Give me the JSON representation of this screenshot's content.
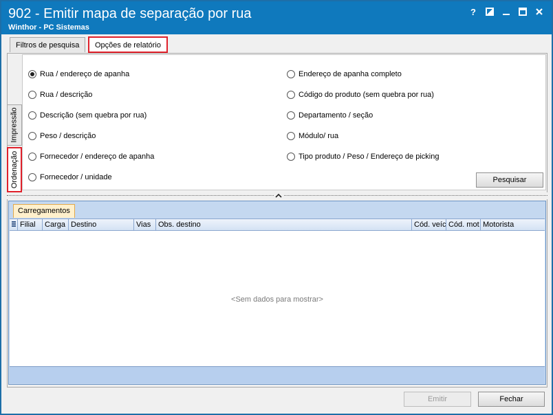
{
  "window": {
    "title": "902 - Emitir mapa de separação por rua",
    "subtitle": "Winthor - PC Sistemas",
    "controls": {
      "help": "?",
      "restore": "restore-icon",
      "minimize": "minimize-icon",
      "maximize": "maximize-icon",
      "close": "close-icon"
    }
  },
  "tabs": [
    {
      "label": "Filtros de pesquisa",
      "active": false
    },
    {
      "label": "Opções de relatório",
      "active": true
    }
  ],
  "side_tabs": [
    {
      "label": "Impressão",
      "active": false
    },
    {
      "label": "Ordenação",
      "active": true
    }
  ],
  "options": {
    "left": [
      {
        "label": "Rua / endereço de apanha",
        "checked": true
      },
      {
        "label": "Rua / descrição",
        "checked": false
      },
      {
        "label": "Descrição (sem quebra por rua)",
        "checked": false
      },
      {
        "label": "Peso / descrição",
        "checked": false
      },
      {
        "label": "Fornecedor / endereço de apanha",
        "checked": false
      },
      {
        "label": "Fornecedor / unidade",
        "checked": false
      }
    ],
    "right": [
      {
        "label": "Endereço de apanha completo",
        "checked": false
      },
      {
        "label": "Código do produto (sem quebra por rua)",
        "checked": false
      },
      {
        "label": "Departamento / seção",
        "checked": false
      },
      {
        "label": "Módulo/ rua",
        "checked": false
      },
      {
        "label": "Tipo produto / Peso / Endereço de picking",
        "checked": false
      }
    ]
  },
  "buttons": {
    "search": "Pesquisar",
    "emit": "Emitir",
    "close": "Fechar"
  },
  "grid": {
    "tab": "Carregamentos",
    "columns": [
      "Filial",
      "Carga",
      "Destino",
      "Vias",
      "Obs. destino",
      "Cód. veíc",
      "Cód. mot",
      "Motorista"
    ],
    "empty_message": "<Sem dados para mostrar>"
  },
  "colors": {
    "titlebar": "#0f79bd",
    "highlight": "#e0202a",
    "grid_accent": "#c4d8f0"
  }
}
